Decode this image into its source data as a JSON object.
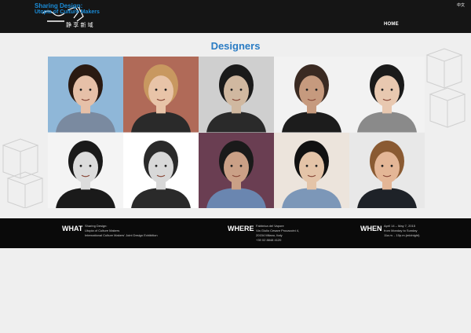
{
  "header": {
    "logo_title": "Sharing Design:",
    "logo_subtitle": "Utopia of Culture Makers",
    "lang_label": "中文",
    "nav_home": "HOME"
  },
  "main": {
    "title": "Designers"
  },
  "designers": [
    {
      "bg": "#8fb7d8",
      "hair": "#2a1a12",
      "skin": "#e6c0a8",
      "shirt": "#7a8aa0"
    },
    {
      "bg": "#b06a58",
      "hair": "#c89860",
      "skin": "#e8c4a8",
      "shirt": "#2a2a2a"
    },
    {
      "bg": "#cfcfcf",
      "hair": "#1a1a1a",
      "skin": "#d0b8a0",
      "shirt": "#2a2a2a"
    },
    {
      "bg": "#f2f2f2",
      "hair": "#3a2a22",
      "skin": "#c69a7e",
      "shirt": "#1c1c1c"
    },
    {
      "bg": "#f2f2f2",
      "hair": "#1a1a1a",
      "skin": "#e8c8b0",
      "shirt": "#8a8a8a"
    },
    {
      "bg": "#f4f4f4",
      "hair": "#1a1a1a",
      "skin": "#dcdcdc",
      "shirt": "#1a1a1a"
    },
    {
      "bg": "#ffffff",
      "hair": "#2a2a2a",
      "skin": "#d8d8d8",
      "shirt": "#2a2a2a"
    },
    {
      "bg": "#6a3e52",
      "hair": "#1a1a1a",
      "skin": "#caa086",
      "shirt": "#6a86b0"
    },
    {
      "bg": "#ece4dc",
      "hair": "#111111",
      "skin": "#e4c4a8",
      "shirt": "#7c97b8"
    },
    {
      "bg": "#e8e8e8",
      "hair": "#8a5a32",
      "skin": "#e4b696",
      "shirt": "#1e2228"
    }
  ],
  "footer": {
    "what": {
      "label": "WHAT",
      "lines": [
        "Sharing Design:",
        "Utopia of Culture Makers",
        "International Culture Makers' Joint Design Exhibition"
      ]
    },
    "where": {
      "label": "WHERE",
      "lines": [
        "Fabbrica del Vapore",
        "Via Giulio Cesare Procaccini 4,",
        "20154 Milano, Italy",
        "+39 02 8848 4120"
      ]
    },
    "when": {
      "label": "WHEN",
      "lines": [
        "April 14 – May 7, 2015",
        "from Monday to Sunday",
        "11a.m. - 10p.m.(midnight)"
      ]
    }
  }
}
